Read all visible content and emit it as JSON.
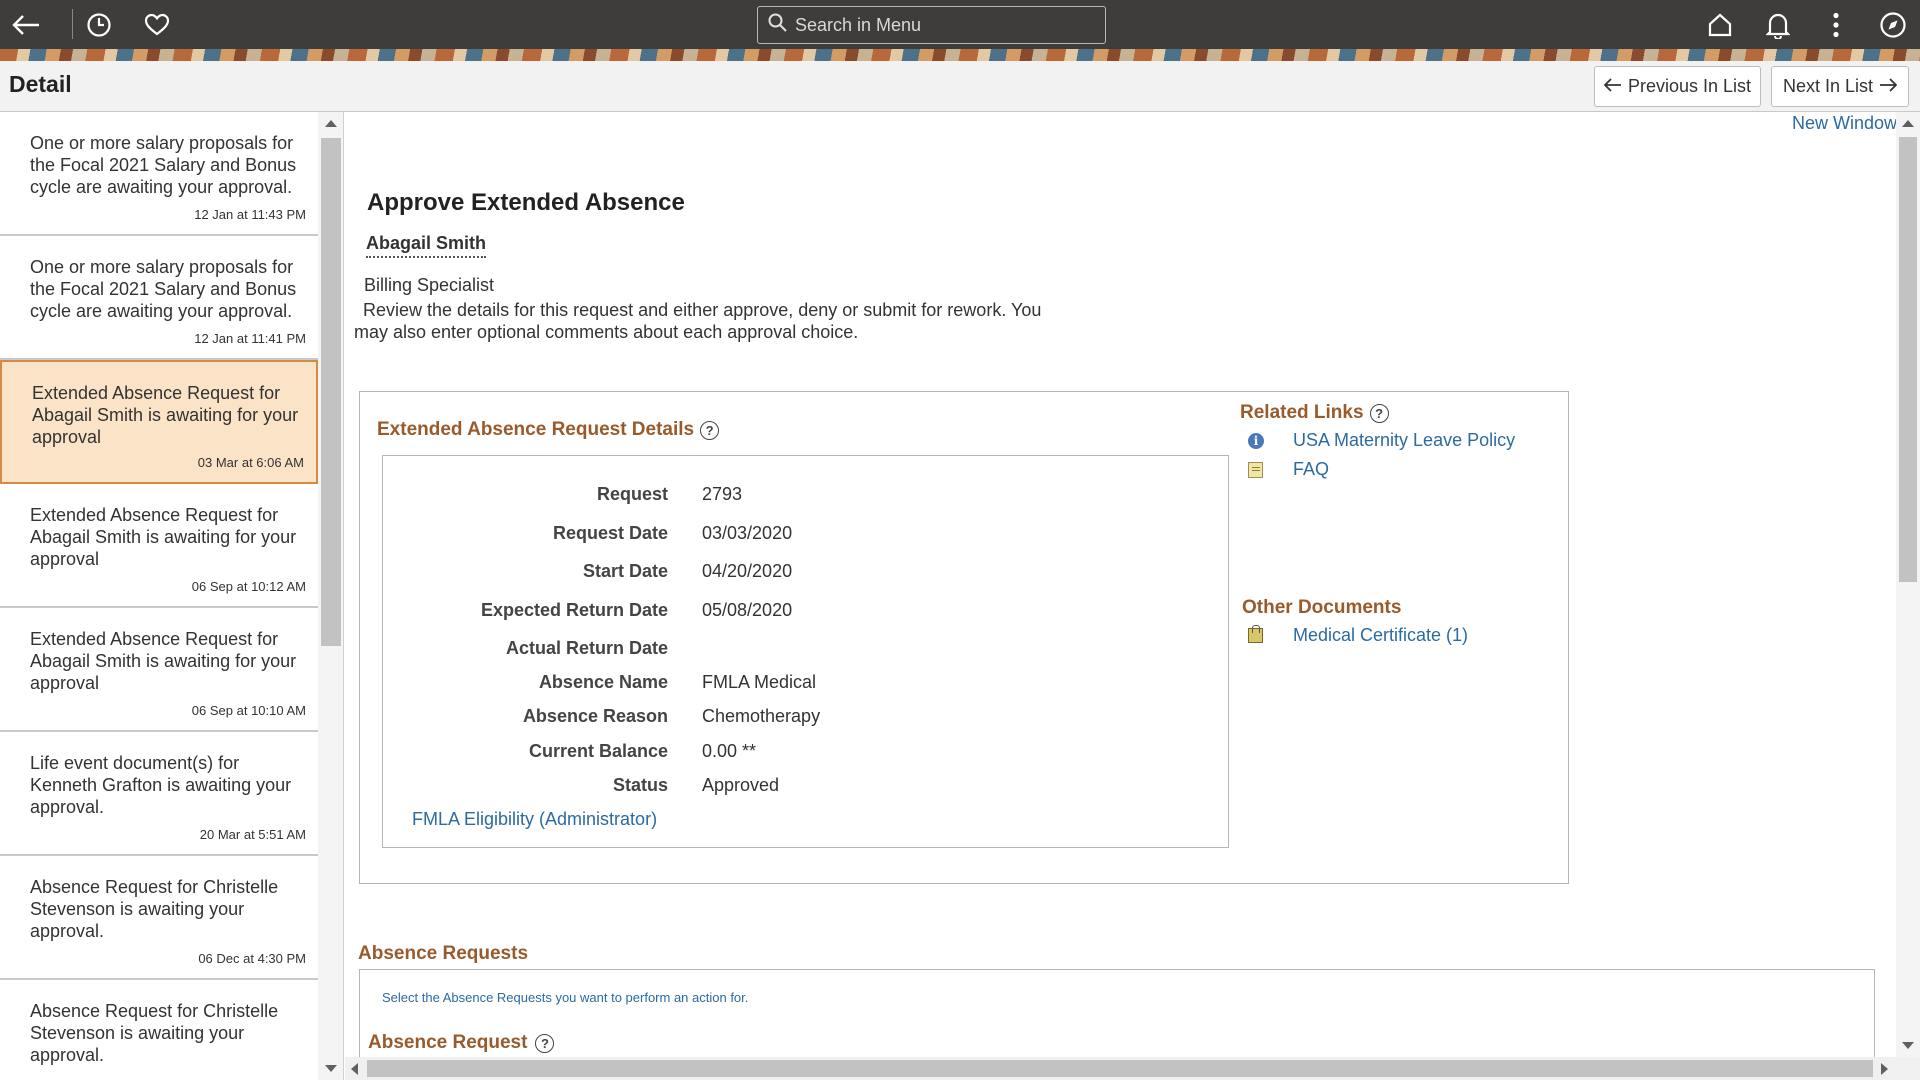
{
  "topbar": {
    "search_placeholder": "Search in Menu",
    "icons": [
      "back-arrow-icon",
      "history-icon",
      "favorites-heart-icon",
      "search-icon",
      "home-icon",
      "notifications-bell-icon",
      "actions-menu-icon",
      "navbar-compass-icon"
    ]
  },
  "header": {
    "title": "Detail",
    "prev_label": "Previous In List",
    "next_label": "Next In List"
  },
  "list": {
    "items": [
      {
        "text": "One or more salary proposals for the Focal 2021 Salary and Bonus cycle are awaiting your approval.",
        "time": "12 Jan at 11:43 PM"
      },
      {
        "text": "One or more salary proposals for the Focal 2021 Salary and Bonus cycle are awaiting your approval.",
        "time": "12 Jan at 11:41 PM"
      },
      {
        "text": "Extended Absence Request for Abagail Smith is awaiting for your approval",
        "time": "03 Mar at 6:06 AM",
        "selected": true
      },
      {
        "text": "Extended Absence Request for Abagail Smith is awaiting for your approval",
        "time": "06 Sep at 10:12 AM"
      },
      {
        "text": "Extended Absence Request for Abagail Smith is awaiting for your approval",
        "time": "06 Sep at 10:10 AM"
      },
      {
        "text": "Life event document(s) for Kenneth Grafton is awaiting your approval.",
        "time": "20 Mar at 5:51 AM"
      },
      {
        "text": "Absence Request for Christelle Stevenson is awaiting your approval.",
        "time": "06 Dec at 4:30 PM"
      },
      {
        "text": "Absence Request for Christelle Stevenson is awaiting your approval.",
        "time": ""
      }
    ]
  },
  "content": {
    "new_window": "New Window",
    "title": "Approve Extended Absence",
    "employee_name": "Abagail Smith",
    "job_title": "Billing Specialist",
    "instructions": "Review the details for this request and either approve, deny or submit for rework. You may also enter optional comments about each approval choice.",
    "details_title": "Extended Absence Request Details",
    "details": [
      {
        "label": "Request",
        "value": "2793"
      },
      {
        "label": "Request Date",
        "value": "03/03/2020"
      },
      {
        "label": "Start Date",
        "value": "04/20/2020"
      },
      {
        "label": "Expected Return Date",
        "value": "05/08/2020"
      },
      {
        "label": "Actual Return Date",
        "value": ""
      },
      {
        "label": "Absence Name",
        "value": "FMLA Medical"
      },
      {
        "label": "Absence Reason",
        "value": "Chemotherapy"
      },
      {
        "label": "Current Balance",
        "value": "0.00 **"
      },
      {
        "label": "Status",
        "value": "Approved"
      }
    ],
    "fmla_link": "FMLA Eligibility (Administrator)",
    "related_links_title": "Related Links",
    "related_links": [
      {
        "label": "USA Maternity Leave Policy",
        "icon": "info-icon"
      },
      {
        "label": "FAQ",
        "icon": "document-icon"
      }
    ],
    "other_docs_title": "Other Documents",
    "other_docs": [
      {
        "label": "Medical Certificate (1)",
        "icon": "attachment-icon"
      }
    ],
    "absence_requests_title": "Absence Requests",
    "absence_requests_instr": "Select the Absence Requests you want to perform an action for.",
    "absence_request_subtitle": "Absence Request"
  },
  "colors": {
    "topbar_bg": "#3f3d3c",
    "section_title": "#995a2c",
    "link": "#2c6aa2",
    "selected_bg": "#fbe3c7",
    "selected_border": "#d58a45"
  }
}
